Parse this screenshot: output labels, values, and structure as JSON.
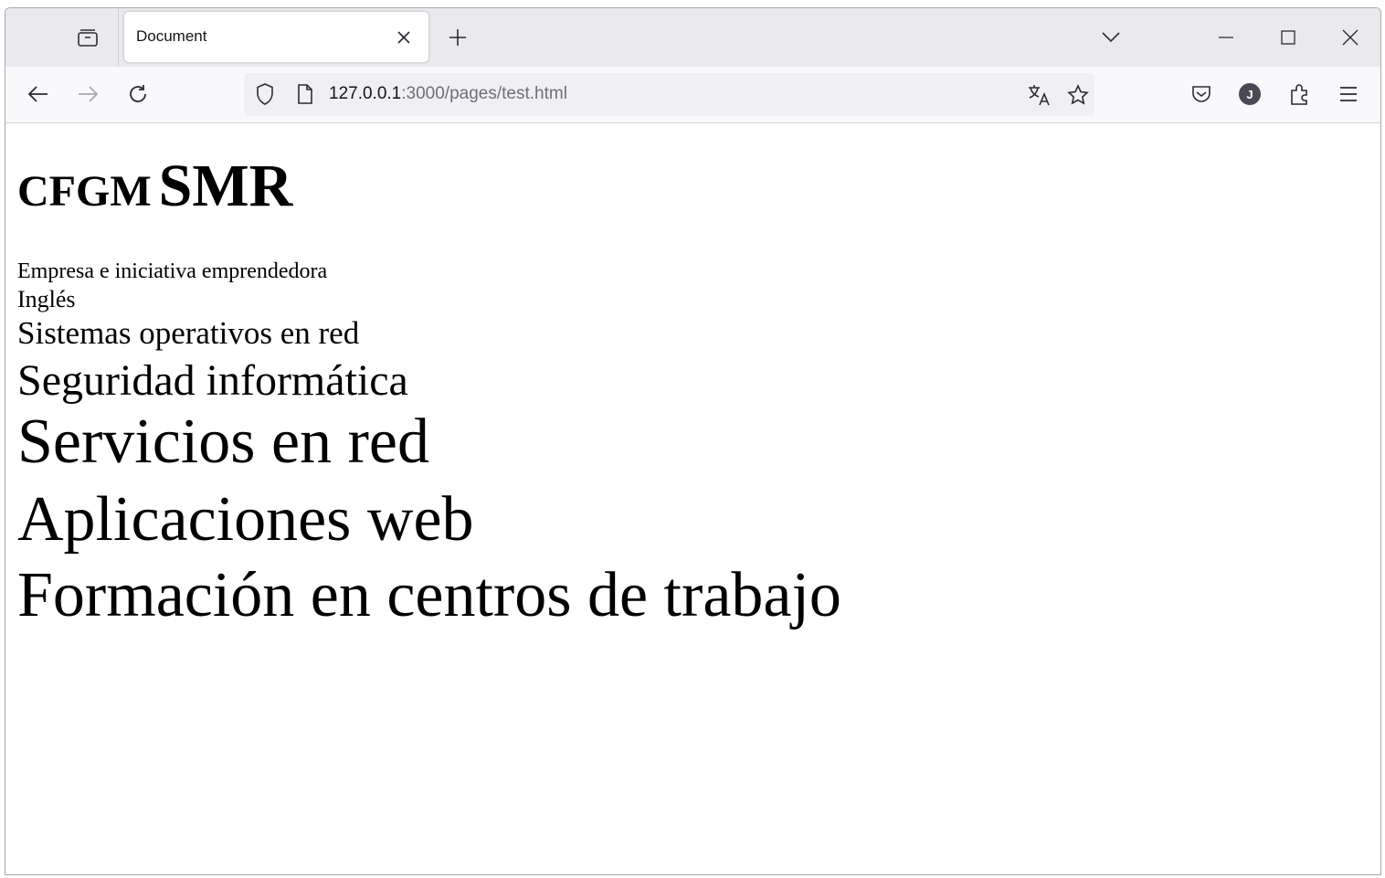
{
  "browser": {
    "tab_title": "Document",
    "url_host": "127.0.0.1",
    "url_path": ":3000/pages/test.html",
    "avatar_initial": "J"
  },
  "page": {
    "heading_small": "CFGM",
    "heading_big": "SMR",
    "modules": [
      "Empresa e iniciativa emprendedora",
      "Inglés",
      "Sistemas operativos en red",
      "Seguridad informática",
      "Servicios en red",
      "Aplicaciones web",
      "Formación en centros de trabajo"
    ]
  }
}
